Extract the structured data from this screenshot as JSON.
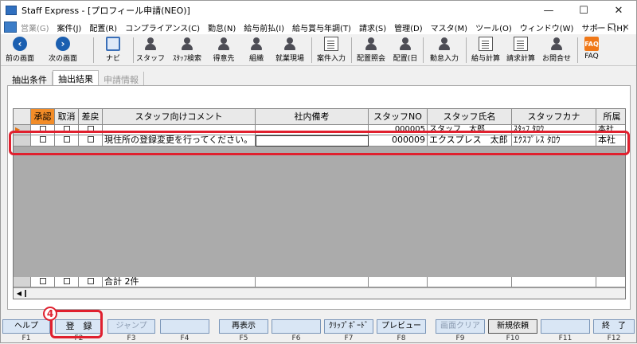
{
  "window": {
    "title": "Staff Express - [プロフィール申請(NEO)]",
    "minimize": "—",
    "maximize": "☐",
    "close": "✕"
  },
  "menu": {
    "items": [
      {
        "label": "営業(G)",
        "disabled": true
      },
      {
        "label": "案件(J)"
      },
      {
        "label": "配置(R)"
      },
      {
        "label": "コンプライアンス(C)"
      },
      {
        "label": "勤怠(N)"
      },
      {
        "label": "給与前払(I)"
      },
      {
        "label": "給与賞与年調(T)"
      },
      {
        "label": "請求(S)"
      },
      {
        "label": "管理(D)"
      },
      {
        "label": "マスタ(M)"
      },
      {
        "label": "ツール(O)"
      },
      {
        "label": "ウィンドウ(W)"
      },
      {
        "label": "サポート(H)"
      }
    ],
    "controls": [
      "—",
      "❐",
      "✕"
    ]
  },
  "toolbar": {
    "prev": "前の画面",
    "next": "次の画面",
    "navi": "ナビ",
    "staff": "スタッフ",
    "staff_search": "ｽﾀｯﾌ検索",
    "client": "得意先",
    "org": "組織",
    "worksite": "就業現場",
    "case_entry": "案件入力",
    "placement_query": "配置照会",
    "placement_day": "配置(日",
    "attendance_entry": "勤怠入力",
    "payroll_calc": "給与計算",
    "billing_calc": "請求計算",
    "inquiry": "お問合せ",
    "faq": "FAQ",
    "faq_icon_text": "FAQ"
  },
  "tabs": [
    {
      "label": "抽出条件"
    },
    {
      "label": "抽出結果",
      "active": true
    },
    {
      "label": "申請情報",
      "disabled": true
    }
  ],
  "grid": {
    "columns": [
      "",
      "承認",
      "取消",
      "差戻",
      "スタッフ向けコメント",
      "社内備考",
      "スタッフNO",
      "スタッフ氏名",
      "スタッフカナ",
      "所属"
    ],
    "rows": [
      {
        "indicator": "▶",
        "comment": "",
        "note": "",
        "staff_no": "000005",
        "name": "スタッフ　太郎",
        "kana": "ｽﾀｯﾌ ﾀﾛｳ",
        "branch": "本社"
      },
      {
        "indicator": "",
        "comment": "現住所の登録変更を行ってください。",
        "note": "",
        "staff_no": "000009",
        "name": "エクスプレス　太郎",
        "kana": "ｴｸｽﾌﾟﾚｽ ﾀﾛｳ",
        "branch": "本社"
      }
    ],
    "total": "合計 2件",
    "scroll_left": "◀"
  },
  "annotation": {
    "step": "4"
  },
  "fkeys": [
    {
      "key": "F1",
      "label": "ヘルプ"
    },
    {
      "key": "F2",
      "label": "登　録"
    },
    {
      "key": "F3",
      "label": "ジャンプ",
      "disabled": true
    },
    {
      "key": "F4",
      "label": ""
    },
    {
      "key": "F5",
      "label": "再表示"
    },
    {
      "key": "F6",
      "label": ""
    },
    {
      "key": "F7",
      "label": "ｸﾘｯﾌﾟﾎﾞｰﾄﾞ"
    },
    {
      "key": "F8",
      "label": "プレビュー"
    },
    {
      "key": "F9",
      "label": "画面クリア",
      "disabled": true
    },
    {
      "key": "F10",
      "label": "新規依頼"
    },
    {
      "key": "F11",
      "label": ""
    },
    {
      "key": "F12",
      "label": "終　了"
    }
  ]
}
